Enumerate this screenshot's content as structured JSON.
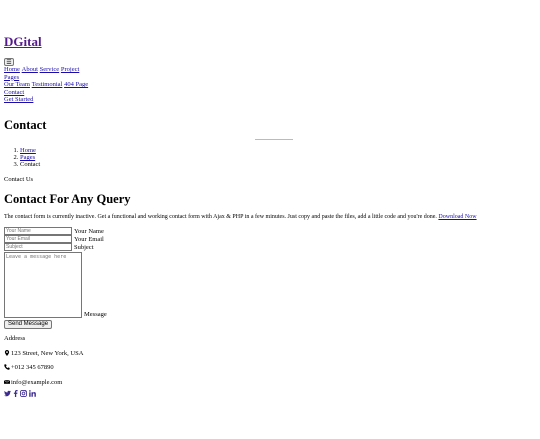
{
  "brand": {
    "name": "DGital"
  },
  "nav": {
    "toggle_label": "☰",
    "items": [
      "Home",
      "About",
      "Service",
      "Project"
    ],
    "pages_label": "Pages",
    "sub_items": [
      "Our Team",
      "Testimonial",
      "404 Page"
    ],
    "contact_label": "Contact",
    "cta_label": "Get Started"
  },
  "header": {
    "title": "Contact"
  },
  "breadcrumb": {
    "items": [
      "Home",
      "Pages",
      "Contact"
    ]
  },
  "section": {
    "label": "Contact Us",
    "title": "Contact For Any Query",
    "note": "The contact form is currently inactive. Get a functional and working contact form with Ajax & PHP in a few minutes. Just copy and paste the files, add a little code and you're done.",
    "note_link": "Download Now"
  },
  "form": {
    "name_placeholder": "Your Name",
    "name_label": "Your Name",
    "email_placeholder": "Your Email",
    "email_label": "Your Email",
    "subject_placeholder": "Subject",
    "subject_label": "Subject",
    "message_placeholder": "Leave a message here",
    "message_label": "Message",
    "submit_label": "Send Message"
  },
  "contact": {
    "address_label": "Address",
    "address": "123 Street, New York, USA",
    "phone": "+012 345 67890",
    "email": "info@example.com"
  },
  "social": {
    "icons": [
      "twitter-icon",
      "facebook-icon",
      "instagram-icon",
      "linkedin-icon"
    ]
  },
  "colors": {
    "link": "#1a0dab",
    "visited": "#551a8b",
    "icon": "#3d2b8f"
  }
}
